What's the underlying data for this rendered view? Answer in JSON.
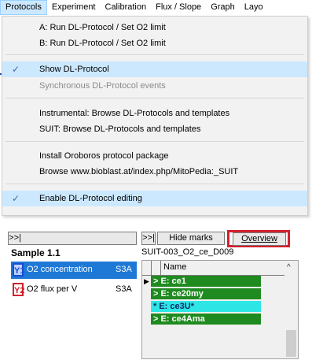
{
  "menubar": {
    "items": [
      "Protocols",
      "Experiment",
      "Calibration",
      "Flux / Slope",
      "Graph",
      "Layo"
    ]
  },
  "dropdown": {
    "items": [
      {
        "label": "A: Run DL-Protocol / Set O2 limit"
      },
      {
        "label": "B: Run DL-Protocol / Set O2 limit"
      },
      {
        "label": "Show DL-Protocol",
        "checked": true
      },
      {
        "label": "Synchronous DL-Protocol events",
        "disabled": true
      },
      {
        "label": "Instrumental: Browse DL-Protocols and templates"
      },
      {
        "label": "SUIT: Browse DL-Protocols and templates"
      },
      {
        "label": "Install Oroboros protocol package"
      },
      {
        "label": "Browse www.bioblast.at/index.php/MitoPedia:_SUIT"
      },
      {
        "label": "Enable DL-Protocol editing",
        "checked": true
      }
    ]
  },
  "panel": {
    "left_nav": ">>|",
    "right_nav": ">>|",
    "hide_marks": "Hide marks",
    "overview": "Overview",
    "sample": "Sample 1.1",
    "protocol": "SUIT-003_O2_ce_D009",
    "channels": [
      {
        "icon": "Y1",
        "label": "O2 concentration",
        "unit": "S3A"
      },
      {
        "icon": "Y2",
        "label": "O2 flux per V",
        "unit": "S3A"
      }
    ],
    "events_header": "Name",
    "events": [
      {
        "label": "> E: ce1",
        "color": "#1f8a1f"
      },
      {
        "label": "> E: ce20my",
        "color": "#1f8a1f"
      },
      {
        "label": "* E: ce3U*",
        "color": "#2fe6e6"
      },
      {
        "label": "> E: ce4Ama",
        "color": "#1f8a1f"
      }
    ],
    "check_glyph": "✓",
    "scroll_up": "^"
  }
}
